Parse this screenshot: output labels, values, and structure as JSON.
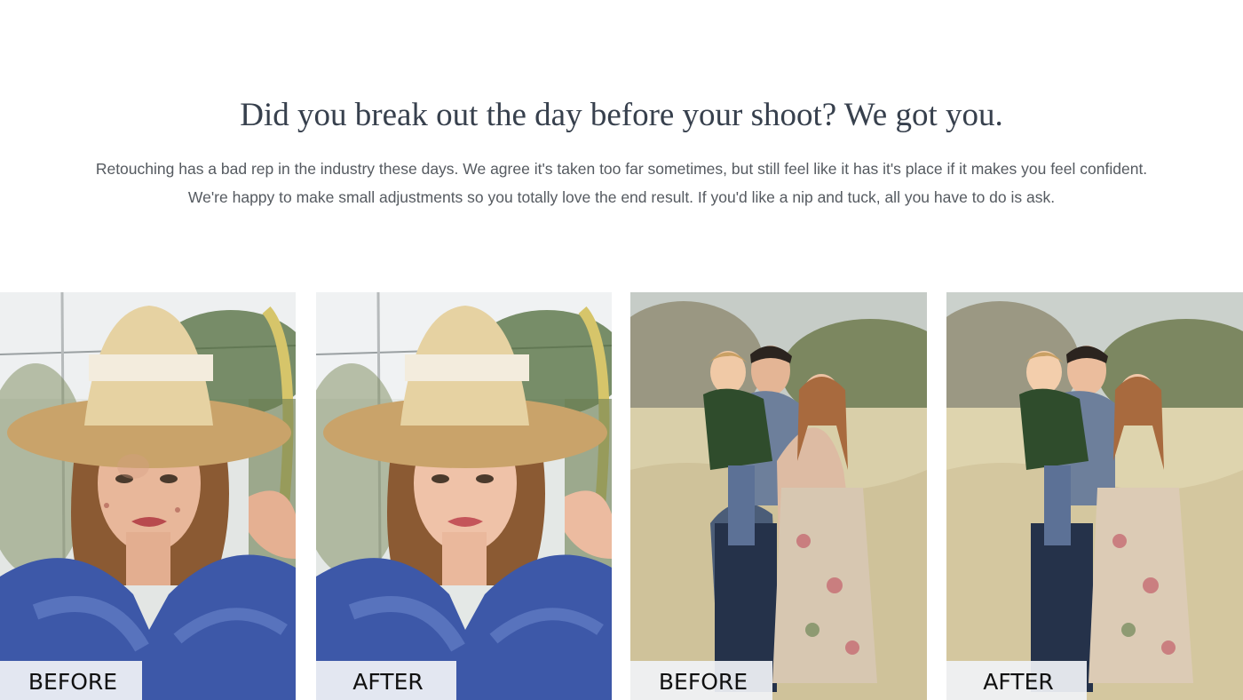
{
  "section": {
    "heading": "Did you break out the day before your shoot? We got you.",
    "body": "Retouching has a bad rep in the industry these days. We agree it's taken too far sometimes, but still feel like it has it's place if it makes you feel confident. We're happy to make small adjustments so you totally love the end result. If you'd like a nip and tuck, all you have to do is ask."
  },
  "gallery": [
    {
      "label": "BEFORE",
      "subject": "woman-in-hat"
    },
    {
      "label": "AFTER",
      "subject": "woman-in-hat"
    },
    {
      "label": "BEFORE",
      "subject": "family-in-field"
    },
    {
      "label": "AFTER",
      "subject": "family-in-field"
    }
  ],
  "colors": {
    "heading": "#37404d",
    "body": "#555a60",
    "label_bg": "#f0f2f6"
  }
}
